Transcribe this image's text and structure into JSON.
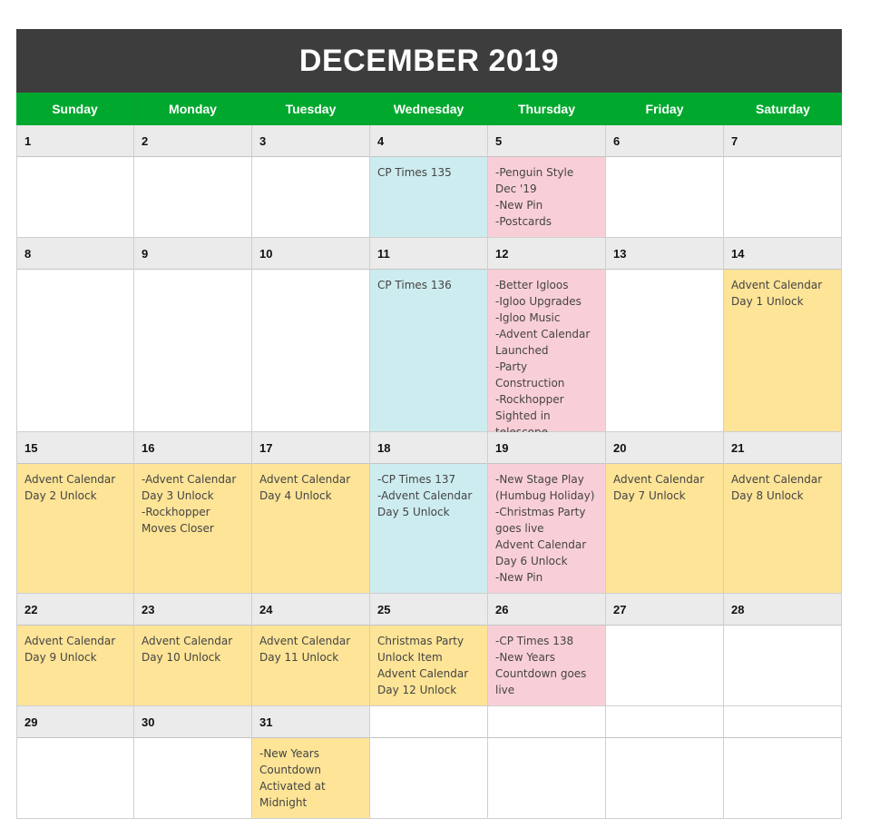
{
  "title": "DECEMBER 2019",
  "days_of_week": [
    "Sunday",
    "Monday",
    "Tuesday",
    "Wednesday",
    "Thursday",
    "Friday",
    "Saturday"
  ],
  "colors": {
    "header_bg": "#3d3d3d",
    "dow_bg": "#00a82d",
    "day_number_bg": "#ebebeb",
    "cp_times": "#cdecef",
    "update": "#f9cfd7",
    "advent": "#fde497"
  },
  "weeks": [
    [
      {
        "day": "1",
        "text": "",
        "color": ""
      },
      {
        "day": "2",
        "text": "",
        "color": ""
      },
      {
        "day": "3",
        "text": "",
        "color": ""
      },
      {
        "day": "4",
        "text": "CP Times 135",
        "color": "blue"
      },
      {
        "day": "5",
        "text": "-Penguin Style Dec '19\n-New Pin\n-Postcards",
        "color": "pink"
      },
      {
        "day": "6",
        "text": "",
        "color": ""
      },
      {
        "day": "7",
        "text": "",
        "color": ""
      }
    ],
    [
      {
        "day": "8",
        "text": "",
        "color": ""
      },
      {
        "day": "9",
        "text": "",
        "color": ""
      },
      {
        "day": "10",
        "text": "",
        "color": ""
      },
      {
        "day": "11",
        "text": "CP Times 136",
        "color": "blue"
      },
      {
        "day": "12",
        "text": "-Better Igloos\n-Igloo Upgrades\n-Igloo Music\n-Advent Calendar Launched\n-Party Construction\n-Rockhopper Sighted in telescope",
        "color": "pink"
      },
      {
        "day": "13",
        "text": "",
        "color": ""
      },
      {
        "day": "14",
        "text": "Advent Calendar Day 1 Unlock",
        "color": "yellow"
      }
    ],
    [
      {
        "day": "15",
        "text": "Advent Calendar Day 2 Unlock",
        "color": "yellow"
      },
      {
        "day": "16",
        "text": "-Advent Calendar Day 3 Unlock\n-Rockhopper Moves Closer",
        "color": "yellow"
      },
      {
        "day": "17",
        "text": "Advent Calendar Day 4 Unlock",
        "color": "yellow"
      },
      {
        "day": "18",
        "text": "-CP Times 137\n-Advent Calendar Day 5 Unlock",
        "color": "blue"
      },
      {
        "day": "19",
        "text": "-New Stage Play (Humbug Holiday)\n-Christmas Party goes live\nAdvent Calendar Day 6 Unlock\n-New Pin",
        "color": "pink"
      },
      {
        "day": "20",
        "text": "Advent Calendar Day 7 Unlock",
        "color": "yellow"
      },
      {
        "day": "21",
        "text": "Advent Calendar Day 8 Unlock",
        "color": "yellow"
      }
    ],
    [
      {
        "day": "22",
        "text": "Advent Calendar Day 9 Unlock",
        "color": "yellow"
      },
      {
        "day": "23",
        "text": "Advent Calendar Day 10 Unlock",
        "color": "yellow"
      },
      {
        "day": "24",
        "text": "Advent Calendar Day 11 Unlock",
        "color": "yellow"
      },
      {
        "day": "25",
        "text": "Christmas Party Unlock Item\nAdvent Calendar Day 12 Unlock",
        "color": "yellow"
      },
      {
        "day": "26",
        "text": "-CP Times 138\n-New Years Countdown goes live",
        "color": "pink"
      },
      {
        "day": "27",
        "text": "",
        "color": ""
      },
      {
        "day": "28",
        "text": "",
        "color": ""
      }
    ],
    [
      {
        "day": "29",
        "text": "",
        "color": ""
      },
      {
        "day": "30",
        "text": "",
        "color": ""
      },
      {
        "day": "31",
        "text": "-New Years Countdown Activated at Midnight",
        "color": "yellow"
      },
      {
        "day": "",
        "text": "",
        "color": ""
      },
      {
        "day": "",
        "text": "",
        "color": ""
      },
      {
        "day": "",
        "text": "",
        "color": ""
      },
      {
        "day": "",
        "text": "",
        "color": ""
      }
    ]
  ]
}
